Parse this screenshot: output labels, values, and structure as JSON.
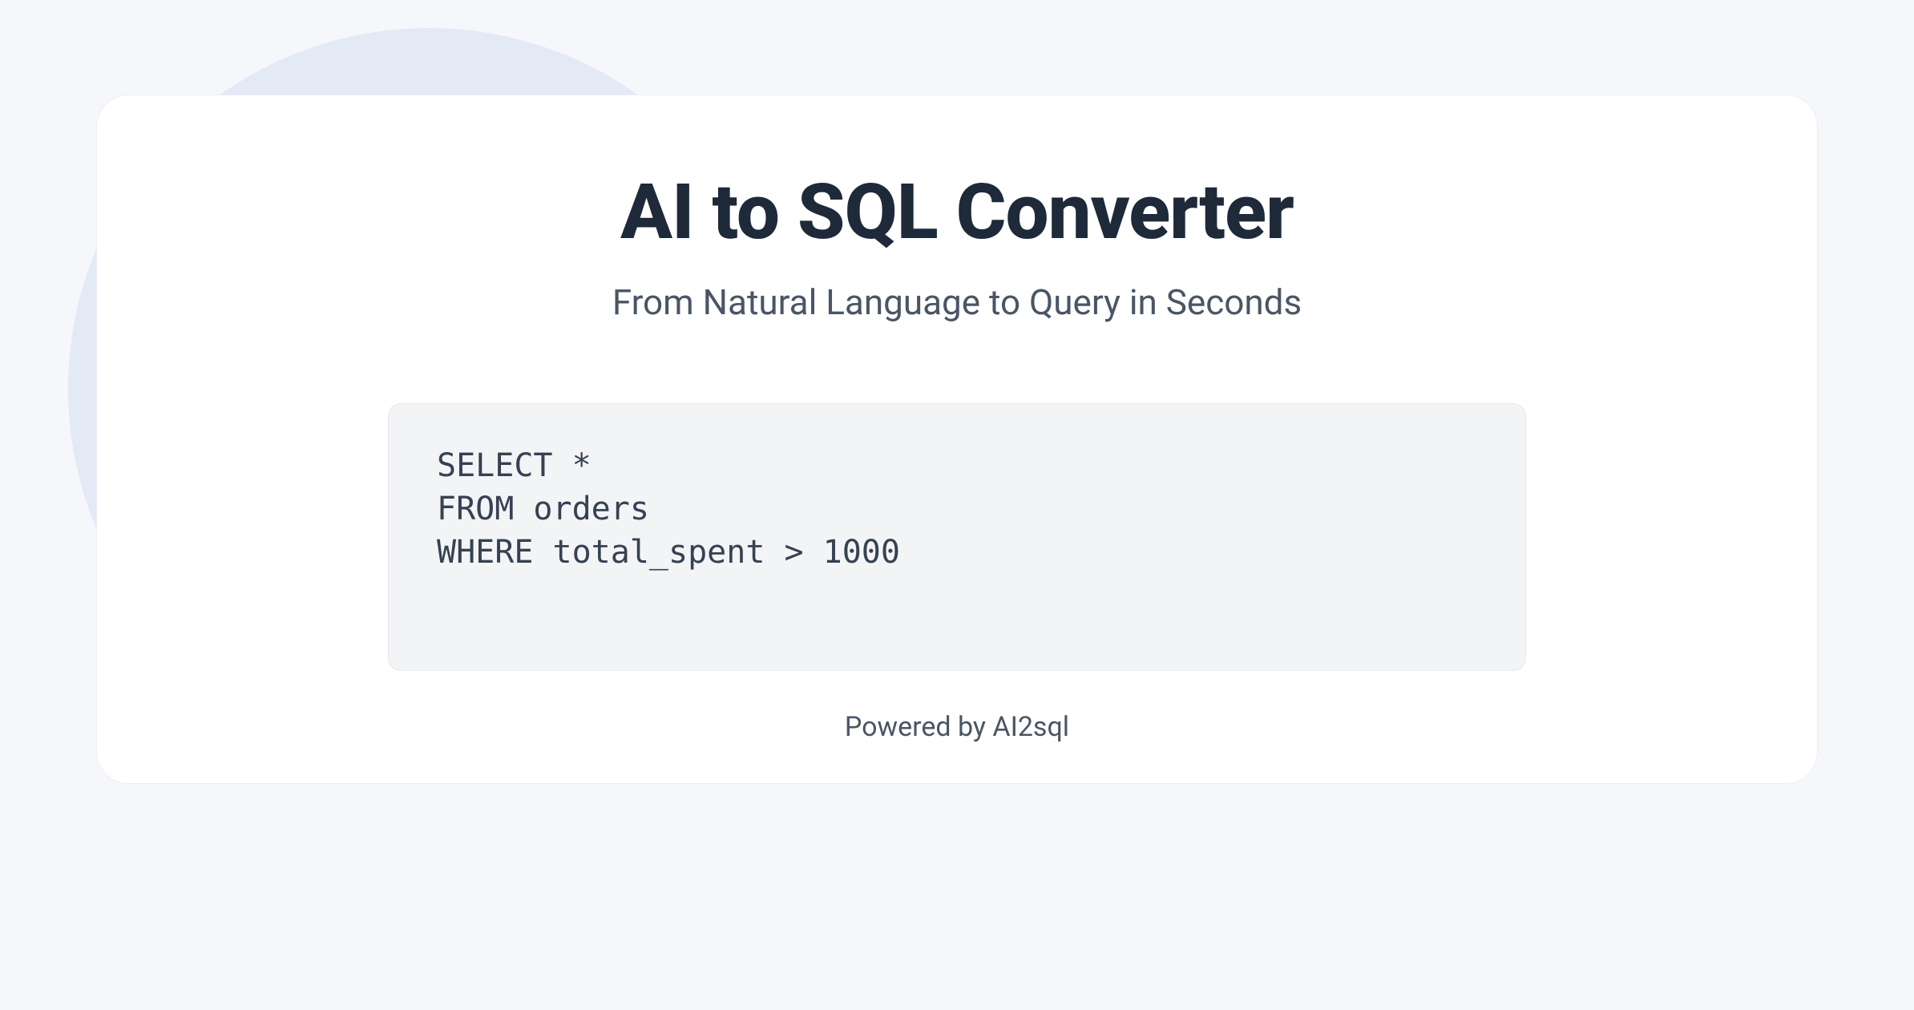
{
  "header": {
    "title": "AI to SQL Converter",
    "subtitle": "From Natural Language to Query in Seconds"
  },
  "code": {
    "content": "SELECT *\nFROM orders\nWHERE total_spent > 1000"
  },
  "footer": {
    "text": "Powered by AI2sql"
  }
}
